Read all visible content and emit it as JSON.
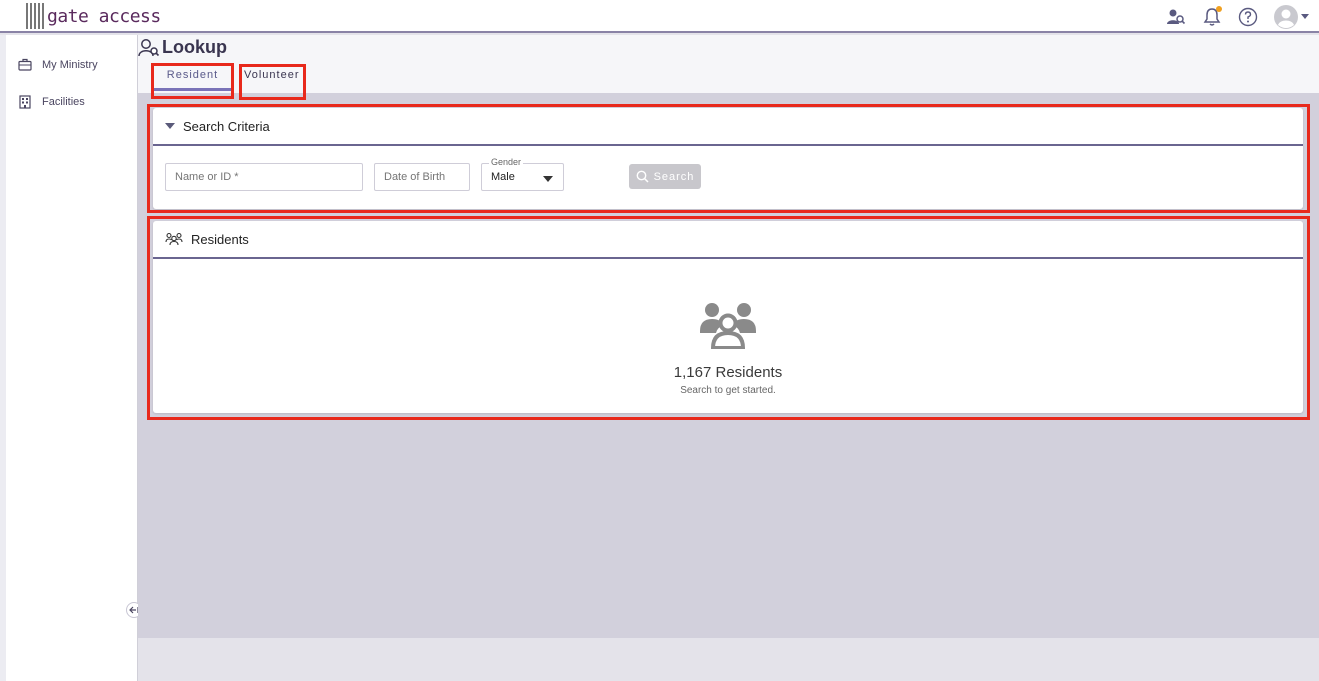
{
  "app": {
    "logo_text": "gate access"
  },
  "sidebar": {
    "items": [
      {
        "label": "My Ministry",
        "icon": "briefcase-icon"
      },
      {
        "label": "Facilities",
        "icon": "building-icon"
      }
    ]
  },
  "page": {
    "title": "Lookup"
  },
  "tabs": [
    {
      "label": "Resident",
      "active": true
    },
    {
      "label": "Volunteer",
      "active": false
    }
  ],
  "search_criteria": {
    "title": "Search Criteria",
    "name_placeholder": "Name or ID *",
    "dob_placeholder": "Date of Birth",
    "gender_label": "Gender",
    "gender_value": "Male",
    "search_label": "Search"
  },
  "residents": {
    "title": "Residents",
    "count_text": "1,167 Residents",
    "hint": "Search to get started."
  },
  "colors": {
    "accent": "#6a6590",
    "highlight": "#e8291c",
    "brand": "#5a2a5d",
    "notification": "#f0a020"
  }
}
